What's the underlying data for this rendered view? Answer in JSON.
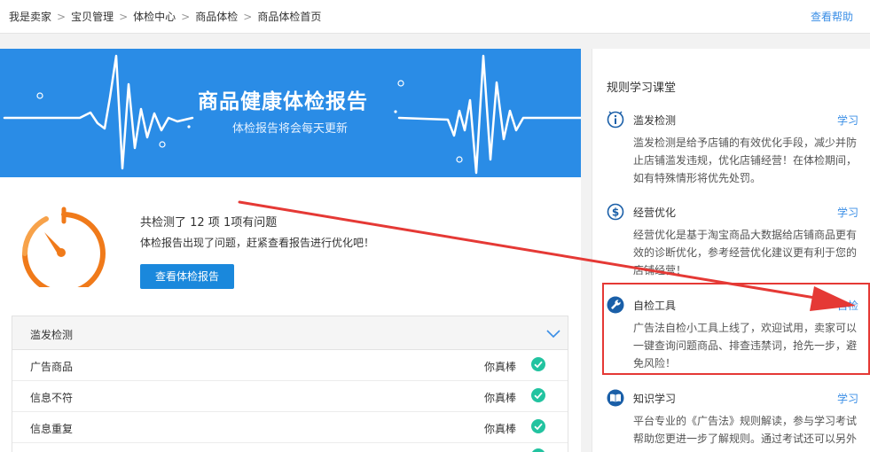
{
  "breadcrumb": [
    "我是卖家",
    "宝贝管理",
    "体检中心",
    "商品体检",
    "商品体检首页"
  ],
  "help_link": "查看帮助",
  "banner": {
    "title": "商品健康体检报告",
    "subtitle": "体检报告将会每天更新"
  },
  "summary": {
    "title": "共检测了 12 项 1项有问题",
    "description": "体检报告出现了问题，赶紧查看报告进行优化吧！",
    "button": "查看体检报告"
  },
  "check_panel": {
    "title": "滥发检测",
    "rows": [
      {
        "name": "广告商品",
        "status": "你真棒"
      },
      {
        "name": "信息不符",
        "status": "你真棒"
      },
      {
        "name": "信息重复",
        "status": "你真棒"
      }
    ]
  },
  "sidebar": {
    "title": "规则学习课堂",
    "cards": [
      {
        "title": "滥发检测",
        "action": "学习",
        "icon": "info-icon",
        "description": "滥发检测是给予店铺的有效优化手段，减少并防止店铺滥发违规，优化店铺经营！在体检期间，如有特殊情形将优先处罚。"
      },
      {
        "title": "经营优化",
        "action": "学习",
        "icon": "dollar-icon",
        "description": "经营优化是基于淘宝商品大数据给店铺商品更有效的诊断优化，参考经营优化建议更有利于您的店铺经营！"
      },
      {
        "title": "自检工具",
        "action": "自检",
        "icon": "wrench-icon",
        "description": "广告法自检小工具上线了，欢迎试用，卖家可以一键查询问题商品、排查违禁词，抢先一步，避免风险！"
      },
      {
        "title": "知识学习",
        "action": "学习",
        "icon": "book-icon",
        "description": "平台专业的《广告法》规则解读，参与学习考试帮助您更进一步了解规则。通过考试还可以另外"
      }
    ]
  },
  "colors": {
    "accent": "#1a88dc",
    "banner": "#2a8ce6",
    "timer": "#f07a1a",
    "ok": "#22c3a0",
    "highlight": "#e53935"
  }
}
